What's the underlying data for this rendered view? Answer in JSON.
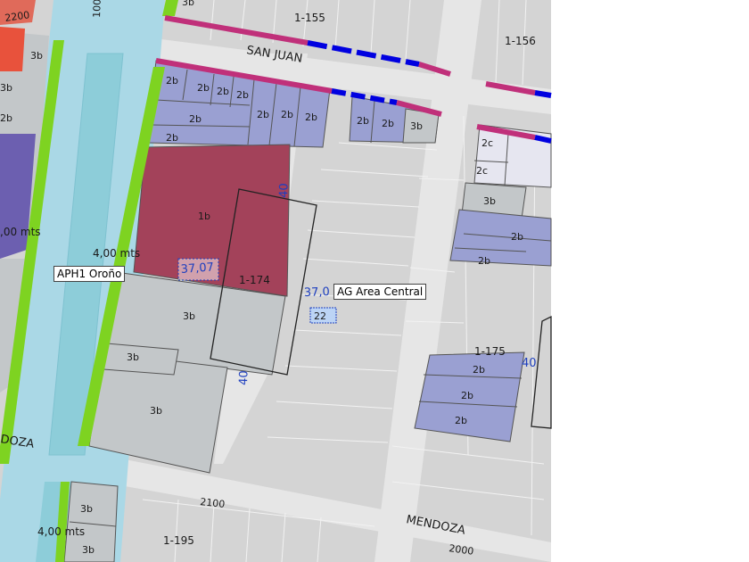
{
  "labels": {
    "street_numbers": [
      "2200",
      "100",
      "2100",
      "2000"
    ],
    "streets": [
      "SAN JUAN",
      "MENDOZA",
      "DOZA"
    ],
    "blocks": [
      "1-155",
      "1-156",
      "1-174",
      "1-175",
      "1-195"
    ],
    "zones": [
      "3b",
      "2b",
      "2c",
      "1b"
    ],
    "measurements": [
      "37,07",
      "40",
      "37,0",
      "4,00 mts",
      ",00 mts"
    ],
    "tags": {
      "aph": "APH1 Oroño",
      "area_central": "AG Area Central"
    },
    "protected_marker": "22"
  },
  "colors": {
    "background": "#ffffff",
    "blocks": "#d4d4d4",
    "street": "#e8e8e8",
    "boulevard": "#aad8e6",
    "median": "#8dcdd9",
    "green_edge": "#7ed321",
    "zone_3b": "#c3c7c9",
    "zone_2b": "#9aa0d2",
    "zone_1b": "#a3425a",
    "zone_2c": "#e6e6f0",
    "zone_red": "#e8523c",
    "zone_purple": "#6c5fb0",
    "measure": "#1e3fbf",
    "line_blue": "#0000e0",
    "line_magenta": "#c0307a"
  }
}
